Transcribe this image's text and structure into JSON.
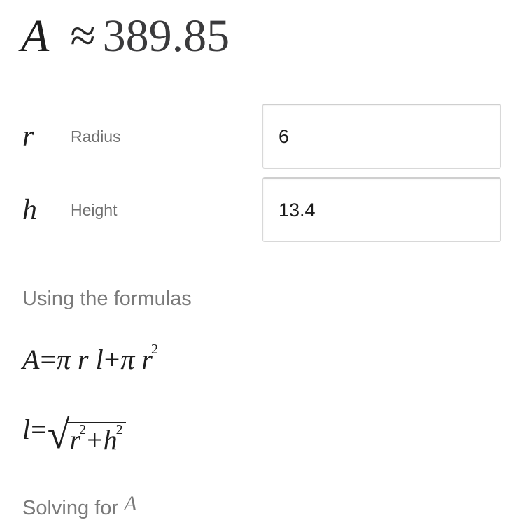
{
  "result": {
    "variable": "A",
    "approx_symbol": "≈",
    "value": "389.85"
  },
  "inputs": [
    {
      "symbol": "r",
      "label": "Radius",
      "value": "6"
    },
    {
      "symbol": "h",
      "label": "Height",
      "value": "13.4"
    }
  ],
  "formulas_heading": "Using the formulas",
  "formulas": {
    "area": {
      "lhs": "A",
      "eq": "=",
      "terms": [
        "π",
        "r",
        "l",
        "+",
        "π",
        "r"
      ],
      "exponent": "2"
    },
    "slant": {
      "lhs": "l",
      "eq": "=",
      "sqrt_symbol": "√",
      "r": "r",
      "r_exp": "2",
      "plus": "+",
      "h": "h",
      "h_exp": "2"
    }
  },
  "solving_heading": {
    "text": "Solving for",
    "variable": "A"
  }
}
